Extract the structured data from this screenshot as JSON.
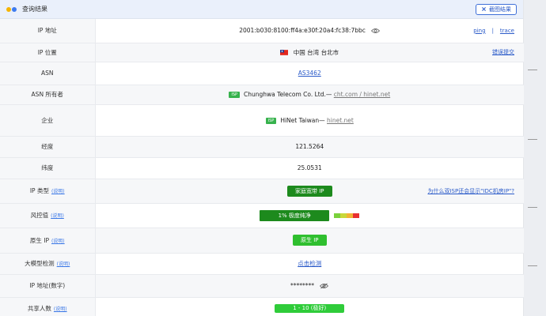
{
  "header": {
    "title": "查询结果",
    "screenshot_label": "截图结果",
    "screenshot_icon": "x-icon"
  },
  "rows": {
    "ip": {
      "label": "IP 地址",
      "value": "2001:b030:8100:ff4a:e30f:20a4:fc38:7bbc",
      "ping": "ping",
      "separator": "|",
      "trace": "trace"
    },
    "location": {
      "label": "IP 位置",
      "value": "中国 台湾 台北市",
      "report": "错误提交"
    },
    "asn": {
      "label": "ASN",
      "value": "AS3462"
    },
    "asn_owner": {
      "label": "ASN 所有者",
      "tag": "ISP",
      "name": "Chunghwa Telecom Co. Ltd.—",
      "domain": "cht.com / hinet.net"
    },
    "company": {
      "label": "企业",
      "tag": "ISP",
      "name": "HiNet Taiwan—",
      "domain": "hinet.net"
    },
    "longitude": {
      "label": "经度",
      "value": "121.5264"
    },
    "latitude": {
      "label": "纬度",
      "value": "25.0531"
    },
    "ip_type": {
      "label": "IP 类型",
      "help": "(说明)",
      "value": "家庭宽带 IP",
      "note": "为什么双ISP还会显示\"IDC机房IP\"?"
    },
    "risk": {
      "label": "风控值",
      "help": "(说明)",
      "value": "1%   极度纯净",
      "scale_colors": [
        "#7ad13c",
        "#c8d83a",
        "#f2b233",
        "#e83030"
      ]
    },
    "native": {
      "label": "原生 IP",
      "help": "(说明)",
      "value": "原生 IP"
    },
    "llm": {
      "label": "大模型检测",
      "help": "(说明)",
      "value": "点击检测"
    },
    "ip_number": {
      "label": "IP 地址(数字)",
      "value": "********"
    },
    "shared": {
      "label": "共享人数",
      "help": "(说明)",
      "value": "1 - 10 (极好)"
    }
  }
}
